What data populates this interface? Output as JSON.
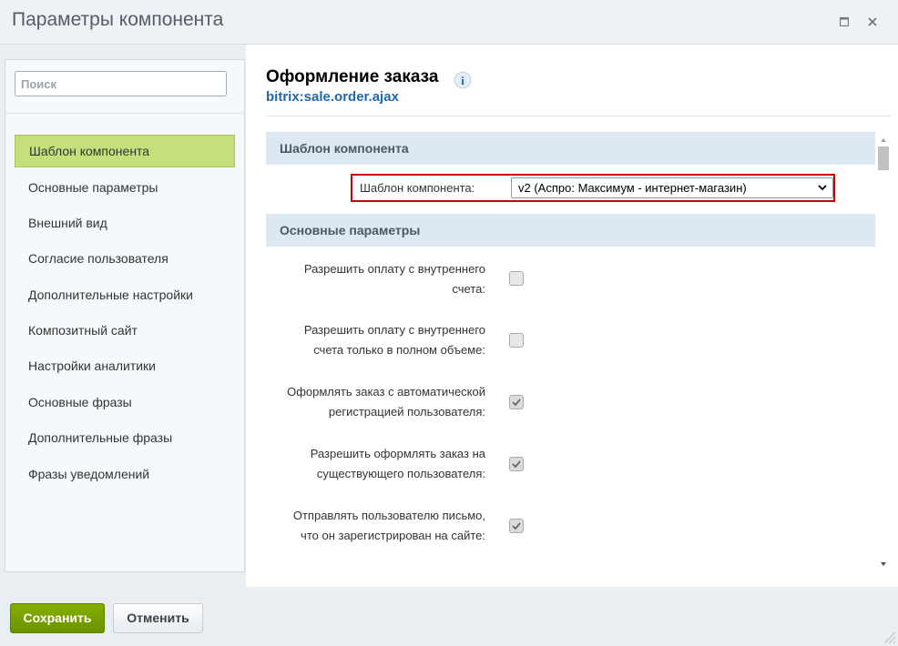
{
  "window": {
    "title": "Параметры компонента",
    "maximize_icon": "maximize-icon",
    "close_icon": "close-icon"
  },
  "sidebar": {
    "search_placeholder": "Поиск",
    "search_value": "",
    "items": [
      {
        "label": "Шаблон компонента",
        "active": true
      },
      {
        "label": "Основные параметры",
        "active": false
      },
      {
        "label": "Внешний вид",
        "active": false
      },
      {
        "label": "Согласие пользователя",
        "active": false
      },
      {
        "label": "Дополнительные настройки",
        "active": false
      },
      {
        "label": "Композитный сайт",
        "active": false
      },
      {
        "label": "Настройки аналитики",
        "active": false
      },
      {
        "label": "Основные фразы",
        "active": false
      },
      {
        "label": "Дополнительные фразы",
        "active": false
      },
      {
        "label": "Фразы уведомлений",
        "active": false
      }
    ]
  },
  "main": {
    "title": "Оформление заказа",
    "info_icon": "info-icon",
    "subtitle": "bitrix:sale.order.ajax",
    "sections": [
      {
        "title": "Шаблон компонента"
      },
      {
        "title": "Основные параметры"
      }
    ],
    "template_field": {
      "label": "Шаблон компонента:",
      "value": "v2 (Аспро: Максимум - интернет-магазин)"
    },
    "params": [
      {
        "line1": "Разрешить оплату с внутреннего",
        "line2": "счета:",
        "checked": false
      },
      {
        "line1": "Разрешить оплату с внутреннего",
        "line2": "счета только в полном объеме:",
        "checked": false
      },
      {
        "line1": "Оформлять заказ с автоматической",
        "line2": "регистрацией пользователя:",
        "checked": true
      },
      {
        "line1": "Разрешить оформлять заказ на",
        "line2": "существующего пользователя:",
        "checked": true
      },
      {
        "line1": "Отправлять пользователю письмо,",
        "line2": "что он зарегистрирован на сайте:",
        "checked": true
      }
    ]
  },
  "footer": {
    "save_label": "Сохранить",
    "cancel_label": "Отменить"
  },
  "colors": {
    "active_item": "#c5e07a",
    "section_header": "#dde8f3",
    "link": "#2067b0",
    "save_button": "#7aa100",
    "highlight_border": "#cc0000"
  }
}
